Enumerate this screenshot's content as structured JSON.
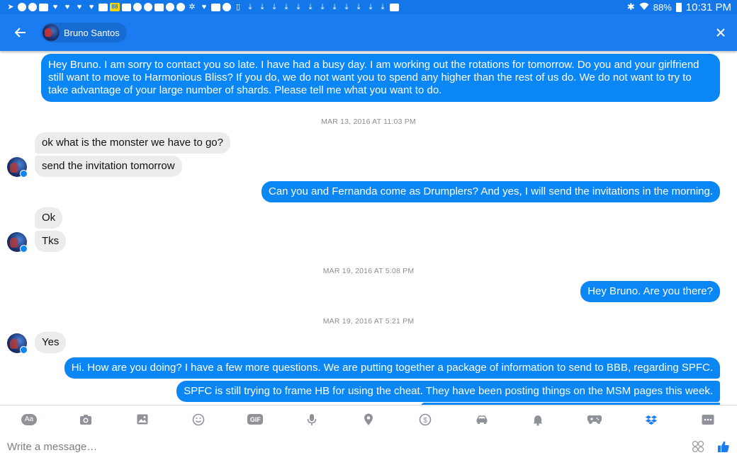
{
  "statusbar": {
    "icons": [
      "navigation-icon",
      "messenger-icon",
      "gps-icon",
      "email-icon",
      "twitter-icon",
      "twitter-icon",
      "twitter-icon",
      "twitter-icon",
      "mail-icon",
      "badge-88-icon",
      "gallery-icon",
      "chrome-icon",
      "chrome-icon",
      "news-icon",
      "messenger-icon",
      "messenger-icon",
      "pinwheel-icon",
      "twitter-icon",
      "calendar-icon",
      "chat-icon",
      "tablet-icon",
      "download-icon",
      "download-icon",
      "download-icon",
      "download-icon",
      "download-icon",
      "download-icon",
      "download-icon",
      "download-icon",
      "download-icon",
      "download-icon",
      "download-icon",
      "download-icon",
      "youtube-icon"
    ],
    "badge_88": "88",
    "battery": "88%",
    "time": "10:31 PM"
  },
  "header": {
    "contact_name": "Bruno Santos"
  },
  "conversation": {
    "messages": [
      {
        "dir": "out",
        "text": "Hey Bruno. I am sorry to contact you so late. I have had a busy day. I am working out the rotations for tomorrow. Do you and your girlfriend still want to move to Harmonious Bliss? If you do, we do not want you to spend any higher than the rest of us do. We do not want to try to take advantage of your large number of shards. Please tell me what you want to do."
      },
      {
        "dir": "ts",
        "text": "MAR 13, 2016 AT 11:03 PM"
      },
      {
        "dir": "in",
        "text": "ok what is the monster we have to go?"
      },
      {
        "dir": "in",
        "text": "send the invitation tomorrow"
      },
      {
        "dir": "out",
        "text": "Can you and Fernanda come as Drumplers? And yes, I will send the invitations in the morning."
      },
      {
        "dir": "in",
        "text": "Ok"
      },
      {
        "dir": "in",
        "text": "Tks"
      },
      {
        "dir": "ts",
        "text": "MAR 19, 2016 AT 5:08 PM"
      },
      {
        "dir": "out",
        "text": "Hey Bruno. Are you there?"
      },
      {
        "dir": "ts",
        "text": "MAR 19, 2016 AT 5:21 PM"
      },
      {
        "dir": "in",
        "text": "Yes"
      },
      {
        "dir": "out",
        "text": "Hi. How are you doing? I have a few more questions. We are putting together a package of information to send to BBB, regarding SPFC."
      },
      {
        "dir": "out",
        "text": "SPFC is still trying to frame HB for using the cheat. They have been posting things on the MSM pages this week."
      }
    ]
  },
  "toolbar": {
    "items": [
      "text-style-icon",
      "camera-icon",
      "image-icon",
      "emoji-icon",
      "gif-icon",
      "microphone-icon",
      "location-icon",
      "payment-icon",
      "car-icon",
      "bell-icon",
      "gamepad-icon",
      "dropbox-icon",
      "more-icon"
    ],
    "aa_label": "Aa",
    "gif_label": "GIF"
  },
  "composer": {
    "placeholder": "Write a message…",
    "value": ""
  },
  "colors": {
    "accent": "#1a7cf0",
    "outgoing_bubble": "#0b86f5",
    "incoming_bubble": "#ececec",
    "timestamp": "#8a8d91"
  }
}
